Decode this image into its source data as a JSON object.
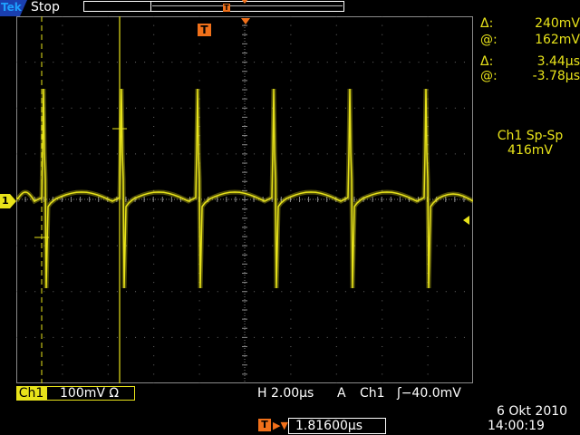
{
  "header": {
    "logo": "Tek",
    "run_status": "Stop"
  },
  "display": {
    "trigger_marker": "T",
    "ch1_marker": "1",
    "record_trigger_marker": "T",
    "trace_color": "#e8e31a",
    "trigger_color": "#f0701a"
  },
  "cursors": {
    "voltage_delta_label": "Δ:",
    "voltage_delta": "240mV",
    "voltage_at_label": "@:",
    "voltage_at": "162mV",
    "time_delta_label": "Δ:",
    "time_delta": "3.44µs",
    "time_at_label": "@:",
    "time_at": "-3.78µs"
  },
  "measurement": {
    "name": "Ch1 Sp-Sp",
    "value": "416mV"
  },
  "status_bar": {
    "channel": "Ch1",
    "channel_scale": "100mV Ω",
    "horizontal_scale": "H 2.00µs",
    "trigger_mode": "A",
    "trigger_source": "Ch1",
    "trigger_level": "ʃ−40.0mV",
    "trigger_position": "1.81600µs",
    "date": "6 Okt  2010",
    "time": "14:00:19"
  }
}
